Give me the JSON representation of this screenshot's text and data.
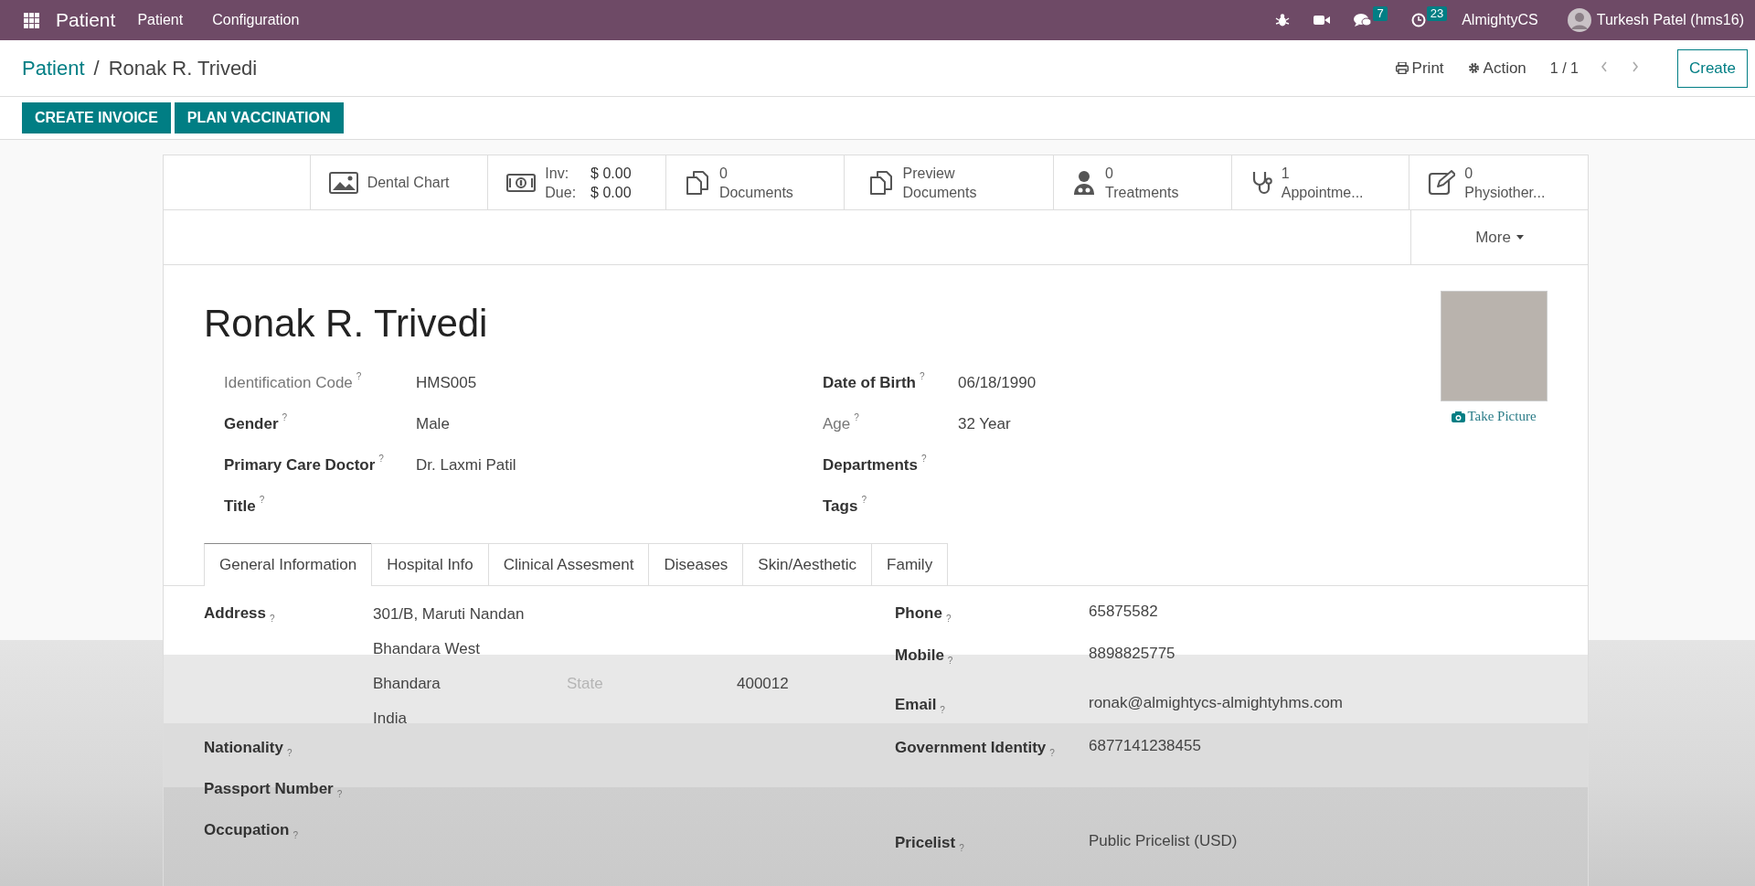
{
  "navbar": {
    "app": "Patient",
    "menus": [
      "Patient",
      "Configuration"
    ],
    "chat_count": "7",
    "activity_count": "23",
    "company": "AlmightyCS",
    "user": "Turkesh Patel (hms16)"
  },
  "breadcrumb": {
    "parent": "Patient",
    "separator": "/",
    "current": "Ronak R. Trivedi"
  },
  "actions": {
    "print": "Print",
    "action": "Action",
    "pager": "1 / 1",
    "create": "Create"
  },
  "header_buttons": [
    "CREATE INVOICE",
    "PLAN VACCINATION"
  ],
  "stat_buttons": [
    {
      "kind": "label",
      "lines": [
        "Dental Chart"
      ]
    },
    {
      "kind": "amounts",
      "rows": [
        {
          "label": "Inv:",
          "value": "$ 0.00"
        },
        {
          "label": "Due:",
          "value": "$ 0.00"
        }
      ]
    },
    {
      "kind": "stat",
      "lines": [
        "0",
        "Documents"
      ]
    },
    {
      "kind": "stat",
      "lines": [
        "Preview",
        "Documents"
      ]
    },
    {
      "kind": "stat",
      "lines": [
        "0",
        "Treatments"
      ]
    },
    {
      "kind": "stat",
      "lines": [
        "1",
        "Appointme..."
      ]
    },
    {
      "kind": "stat",
      "lines": [
        "0",
        "Physiother..."
      ]
    }
  ],
  "more_button": "More",
  "patient": {
    "name": "Ronak R. Trivedi",
    "take_picture": "Take Picture",
    "left_fields": [
      {
        "label": "Identification Code",
        "help": "?",
        "value": "HMS005",
        "readonly": true
      },
      {
        "label": "Gender",
        "help": "?",
        "value": "Male",
        "readonly": false
      },
      {
        "label": "Primary Care Doctor",
        "help": "?",
        "value": "Dr. Laxmi Patil",
        "readonly": false
      },
      {
        "label": "Title",
        "help": "?",
        "readonly": false
      }
    ],
    "right_fields": [
      {
        "label": "Date of Birth",
        "help": "?",
        "value": "06/18/1990",
        "readonly": false
      },
      {
        "label": "Age",
        "help": "?",
        "value": "32 Year",
        "readonly": true
      },
      {
        "label": "Departments",
        "help": "?",
        "readonly": false
      },
      {
        "label": "Tags",
        "help": "?",
        "readonly": false
      }
    ]
  },
  "tabs": [
    {
      "label": "General Information",
      "selected": true
    },
    {
      "label": "Hospital Info",
      "selected": false
    },
    {
      "label": "Clinical Assesment",
      "selected": false
    },
    {
      "label": "Diseases",
      "selected": false
    },
    {
      "label": "Skin/Aesthetic",
      "selected": false
    },
    {
      "label": "Family",
      "selected": false
    }
  ],
  "general": {
    "address": {
      "label": "Address",
      "help": "?",
      "street": "301/B, Maruti Nandan",
      "street2": "Bhandara West",
      "city": "Bhandara",
      "state_placeholder": "State",
      "zip": "400012",
      "country": "India"
    },
    "left_fields": [
      {
        "label": "Nationality",
        "help": "?"
      },
      {
        "label": "Passport Number",
        "help": "?"
      },
      {
        "label": "Occupation",
        "help": "?"
      }
    ],
    "right_fields": [
      {
        "label": "Phone",
        "help": "?",
        "value": "65875582"
      },
      {
        "label": "Mobile",
        "help": "?",
        "value": "8898825775"
      },
      {
        "label": "Email",
        "help": "?",
        "value": "ronak@almightycs-almightyhms.com"
      },
      {
        "label": "Government Identity",
        "help": "?",
        "value": "6877141238455"
      },
      {
        "label": "Pricelist",
        "help": "?",
        "value": "Public Pricelist (USD)"
      }
    ]
  }
}
